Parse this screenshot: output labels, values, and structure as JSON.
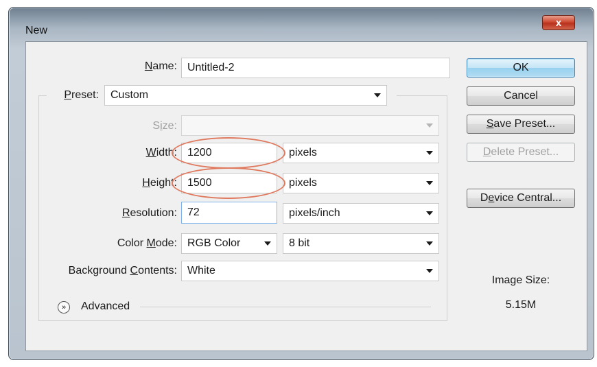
{
  "window": {
    "title": "New",
    "close_glyph": "x"
  },
  "form": {
    "name": {
      "label_u": "N",
      "label_rest": "ame:",
      "value": "Untitled-2"
    },
    "preset": {
      "label_u": "P",
      "label_rest": "reset:",
      "value": "Custom"
    },
    "size": {
      "label_pre": "S",
      "label_u": "i",
      "label_rest": "ze:",
      "value": ""
    },
    "width": {
      "label_u": "W",
      "label_rest": "idth:",
      "value": "1200",
      "unit": "pixels"
    },
    "height": {
      "label_u": "H",
      "label_rest": "eight:",
      "value": "1500",
      "unit": "pixels"
    },
    "resolution": {
      "label_u": "R",
      "label_rest": "esolution:",
      "value": "72",
      "unit": "pixels/inch"
    },
    "color_mode": {
      "label_pre": "Color ",
      "label_u": "M",
      "label_rest": "ode:",
      "value": "RGB Color",
      "depth": "8 bit"
    },
    "background": {
      "label_pre": "Background ",
      "label_u": "C",
      "label_rest": "ontents:",
      "value": "White"
    },
    "advanced": {
      "label": "Advanced",
      "icon": "chevron-double-down-icon"
    }
  },
  "buttons": {
    "ok": "OK",
    "cancel": "Cancel",
    "save_preset_u": "S",
    "save_preset_rest": "ave Preset...",
    "delete_preset_u": "D",
    "delete_preset_rest": "elete Preset...",
    "device_central_pre": "D",
    "device_central_u": "e",
    "device_central_rest": "vice Central..."
  },
  "image_size": {
    "label": "Image Size:",
    "value": "5.15M"
  },
  "colors": {
    "annotation": "#e07a5f",
    "default_button": "#98d1ef",
    "close_button": "#cf4a32"
  }
}
